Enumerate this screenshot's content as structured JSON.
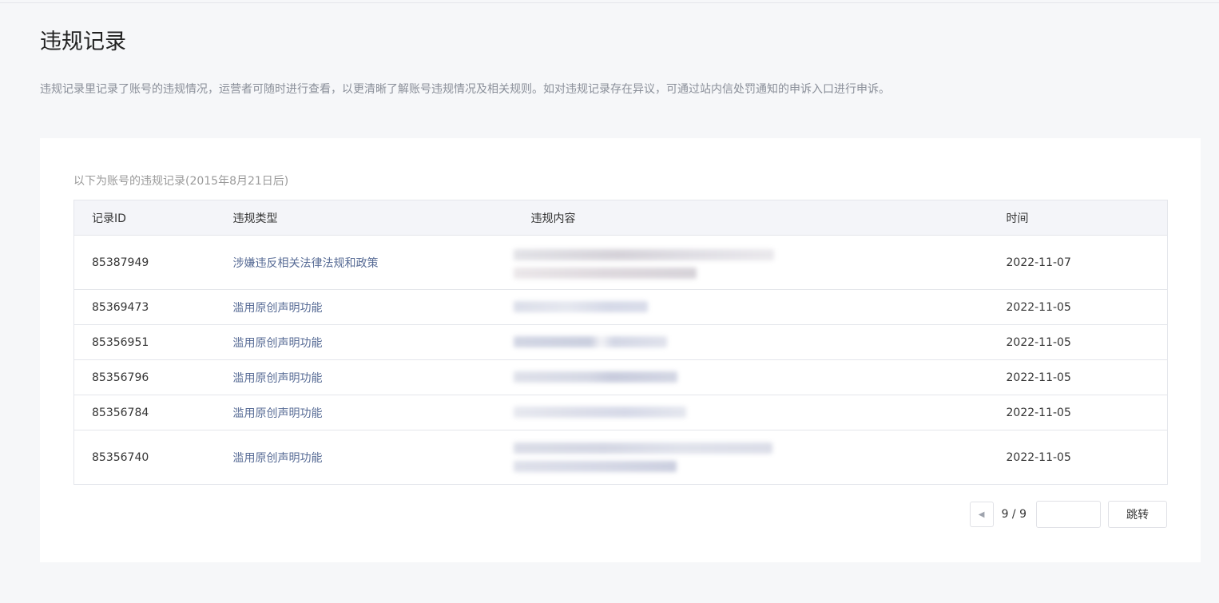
{
  "page": {
    "title": "违规记录",
    "description": "违规记录里记录了账号的违规情况，运营者可随时进行查看，以更清晰了解账号违规情况及相关规则。如对违规记录存在异议，可通过站内信处罚通知的申诉入口进行申诉。"
  },
  "table": {
    "caption": "以下为账号的违规记录(2015年8月21日后)",
    "columns": [
      "记录ID",
      "违规类型",
      "违规内容",
      "时间"
    ],
    "rows": [
      {
        "id": "85387949",
        "type": "涉嫌违反相关法律法规和政策",
        "content": "(redacted)",
        "time": "2022-11-07"
      },
      {
        "id": "85369473",
        "type": "滥用原创声明功能",
        "content": "(redacted)",
        "time": "2022-11-05"
      },
      {
        "id": "85356951",
        "type": "滥用原创声明功能",
        "content": "(redacted)",
        "time": "2022-11-05"
      },
      {
        "id": "85356796",
        "type": "滥用原创声明功能",
        "content": "(redacted)",
        "time": "2022-11-05"
      },
      {
        "id": "85356784",
        "type": "滥用原创声明功能",
        "content": "(redacted)",
        "time": "2022-11-05"
      },
      {
        "id": "85356740",
        "type": "滥用原创声明功能",
        "content": "(redacted)",
        "time": "2022-11-05"
      }
    ]
  },
  "pagination": {
    "prev_icon": "triangle-left-icon",
    "page_label": "9 / 9",
    "input_value": "",
    "jump_label": "跳转"
  },
  "colors": {
    "background": "#f6f7f9",
    "card": "#ffffff",
    "link": "#576b95",
    "border": "#e4e6eb",
    "header_bg": "#f4f5f9"
  }
}
